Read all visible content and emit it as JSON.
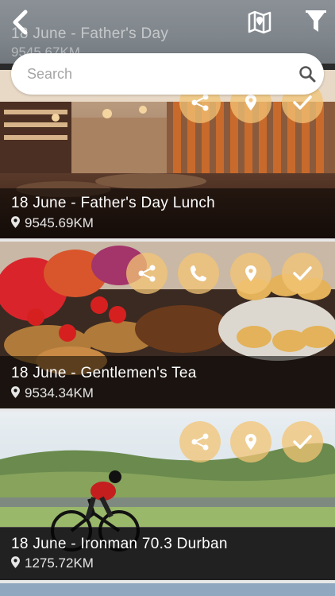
{
  "header": {
    "back_icon": "chevron-left-icon",
    "map_icon": "map-icon",
    "filter_icon": "funnel-icon",
    "ghost_title": "18 June - Father's Day",
    "ghost_distance": "9545.67KM"
  },
  "search": {
    "placeholder": "Search",
    "value": ""
  },
  "events": [
    {
      "title": "18 June - Father's Day Lunch",
      "distance": "9545.69KM",
      "actions": [
        "share-icon",
        "location-pin-icon",
        "check-icon"
      ]
    },
    {
      "title": "18 June - Gentlemen's Tea",
      "distance": "9534.34KM",
      "actions": [
        "share-icon",
        "phone-icon",
        "location-pin-icon",
        "check-icon"
      ]
    },
    {
      "title": "18 June - Ironman 70.3 Durban",
      "distance": "1275.72KM",
      "actions": [
        "share-icon",
        "location-pin-icon",
        "check-icon"
      ]
    }
  ],
  "colors": {
    "action_bubble": "#f3c476",
    "caption_bg": "#000000",
    "search_bg": "#ffffff"
  }
}
